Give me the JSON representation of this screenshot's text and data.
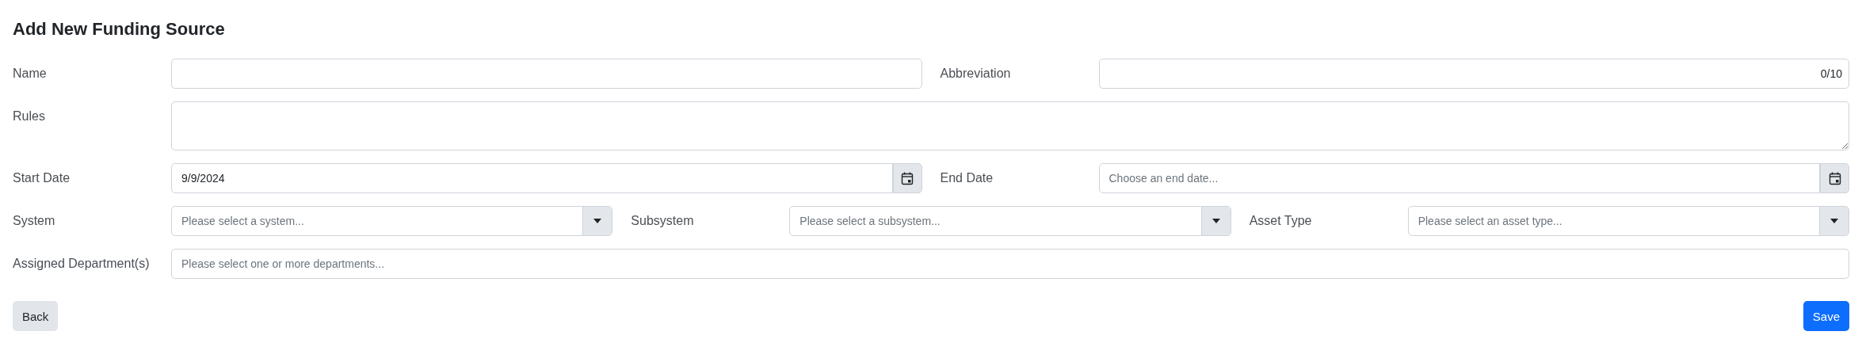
{
  "title": "Add New Funding Source",
  "rows": [
    {
      "fields": [
        {
          "label": "Name",
          "kind": "text"
        },
        {
          "label": "Abbreviation",
          "kind": "text",
          "counter": "0/10"
        }
      ]
    },
    {
      "fields": [
        {
          "label": "Rules",
          "kind": "textarea"
        }
      ]
    },
    {
      "fields": [
        {
          "label": "Start Date",
          "kind": "date",
          "value": "9/9/2024"
        },
        {
          "label": "End Date",
          "kind": "date",
          "placeholder": "Choose an end date..."
        }
      ]
    },
    {
      "fields": [
        {
          "label": "System",
          "kind": "select",
          "placeholder": "Please select a system..."
        },
        {
          "label": "Subsystem",
          "kind": "select",
          "placeholder": "Please select a subsystem..."
        },
        {
          "label": "Asset Type",
          "kind": "select",
          "placeholder": "Please select an asset type..."
        }
      ]
    },
    {
      "fields": [
        {
          "label": "Assigned Department(s)",
          "kind": "multiselect",
          "placeholder": "Please select one or more departments..."
        }
      ]
    }
  ],
  "buttons": [
    {
      "label": "Back",
      "kind": "secondary"
    },
    {
      "label": "Save",
      "kind": "primary"
    }
  ]
}
